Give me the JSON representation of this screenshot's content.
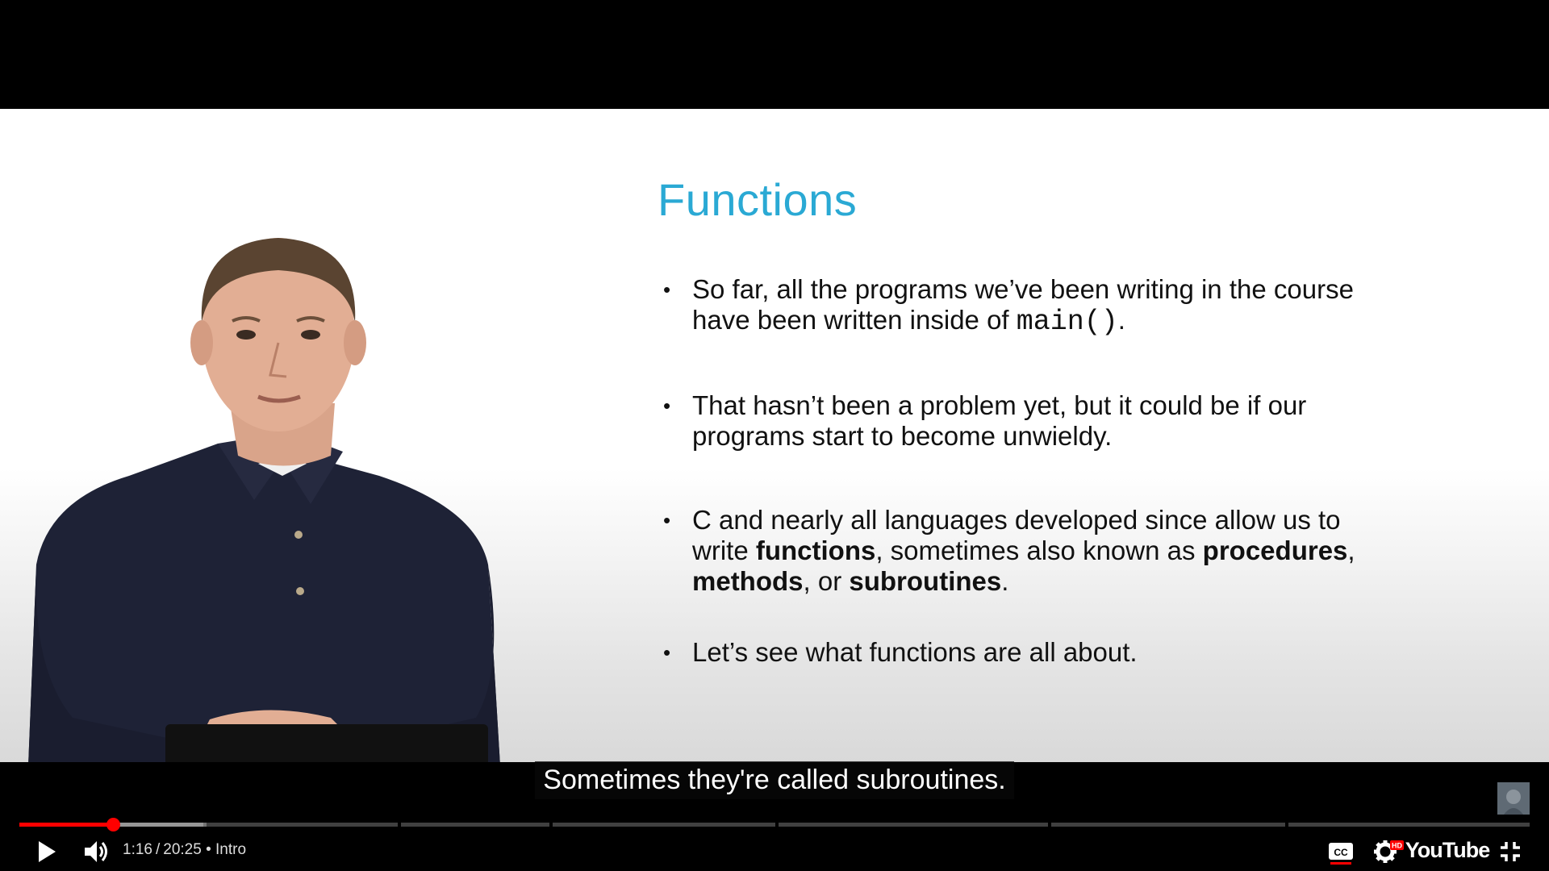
{
  "slide": {
    "title": "Functions",
    "bullet1_a": "So far, all the programs we’ve been writing in the course have been written inside of ",
    "bullet1_code": "main()",
    "bullet1_b": ".",
    "bullet2": "That hasn’t been a problem yet, but it could be if our programs start to become unwieldy.",
    "bullet3_a": "C and nearly all languages developed since allow us to write ",
    "bullet3_b1": "functions",
    "bullet3_c": ", sometimes also known as ",
    "bullet3_b2": "procedures",
    "bullet3_d": ", ",
    "bullet3_b3": "methods",
    "bullet3_e": ", or ",
    "bullet3_b4": "subroutines",
    "bullet3_f": ".",
    "bullet4": "Let’s see what functions are all about.",
    "title_color": "#2aa9d4"
  },
  "caption": "Sometimes they're called subroutines.",
  "player": {
    "current_time": "1:16",
    "separator": "/",
    "duration": "20:25",
    "chapter": "• Intro",
    "progress_fraction": 0.062,
    "logo_text": "YouTube",
    "hd_badge": "HD",
    "cc_label": "CC",
    "accent_color": "#ff0000"
  },
  "icons": [
    "play-icon",
    "volume-icon",
    "cc-icon",
    "settings-icon",
    "youtube-logo",
    "exit-fullscreen-icon"
  ]
}
